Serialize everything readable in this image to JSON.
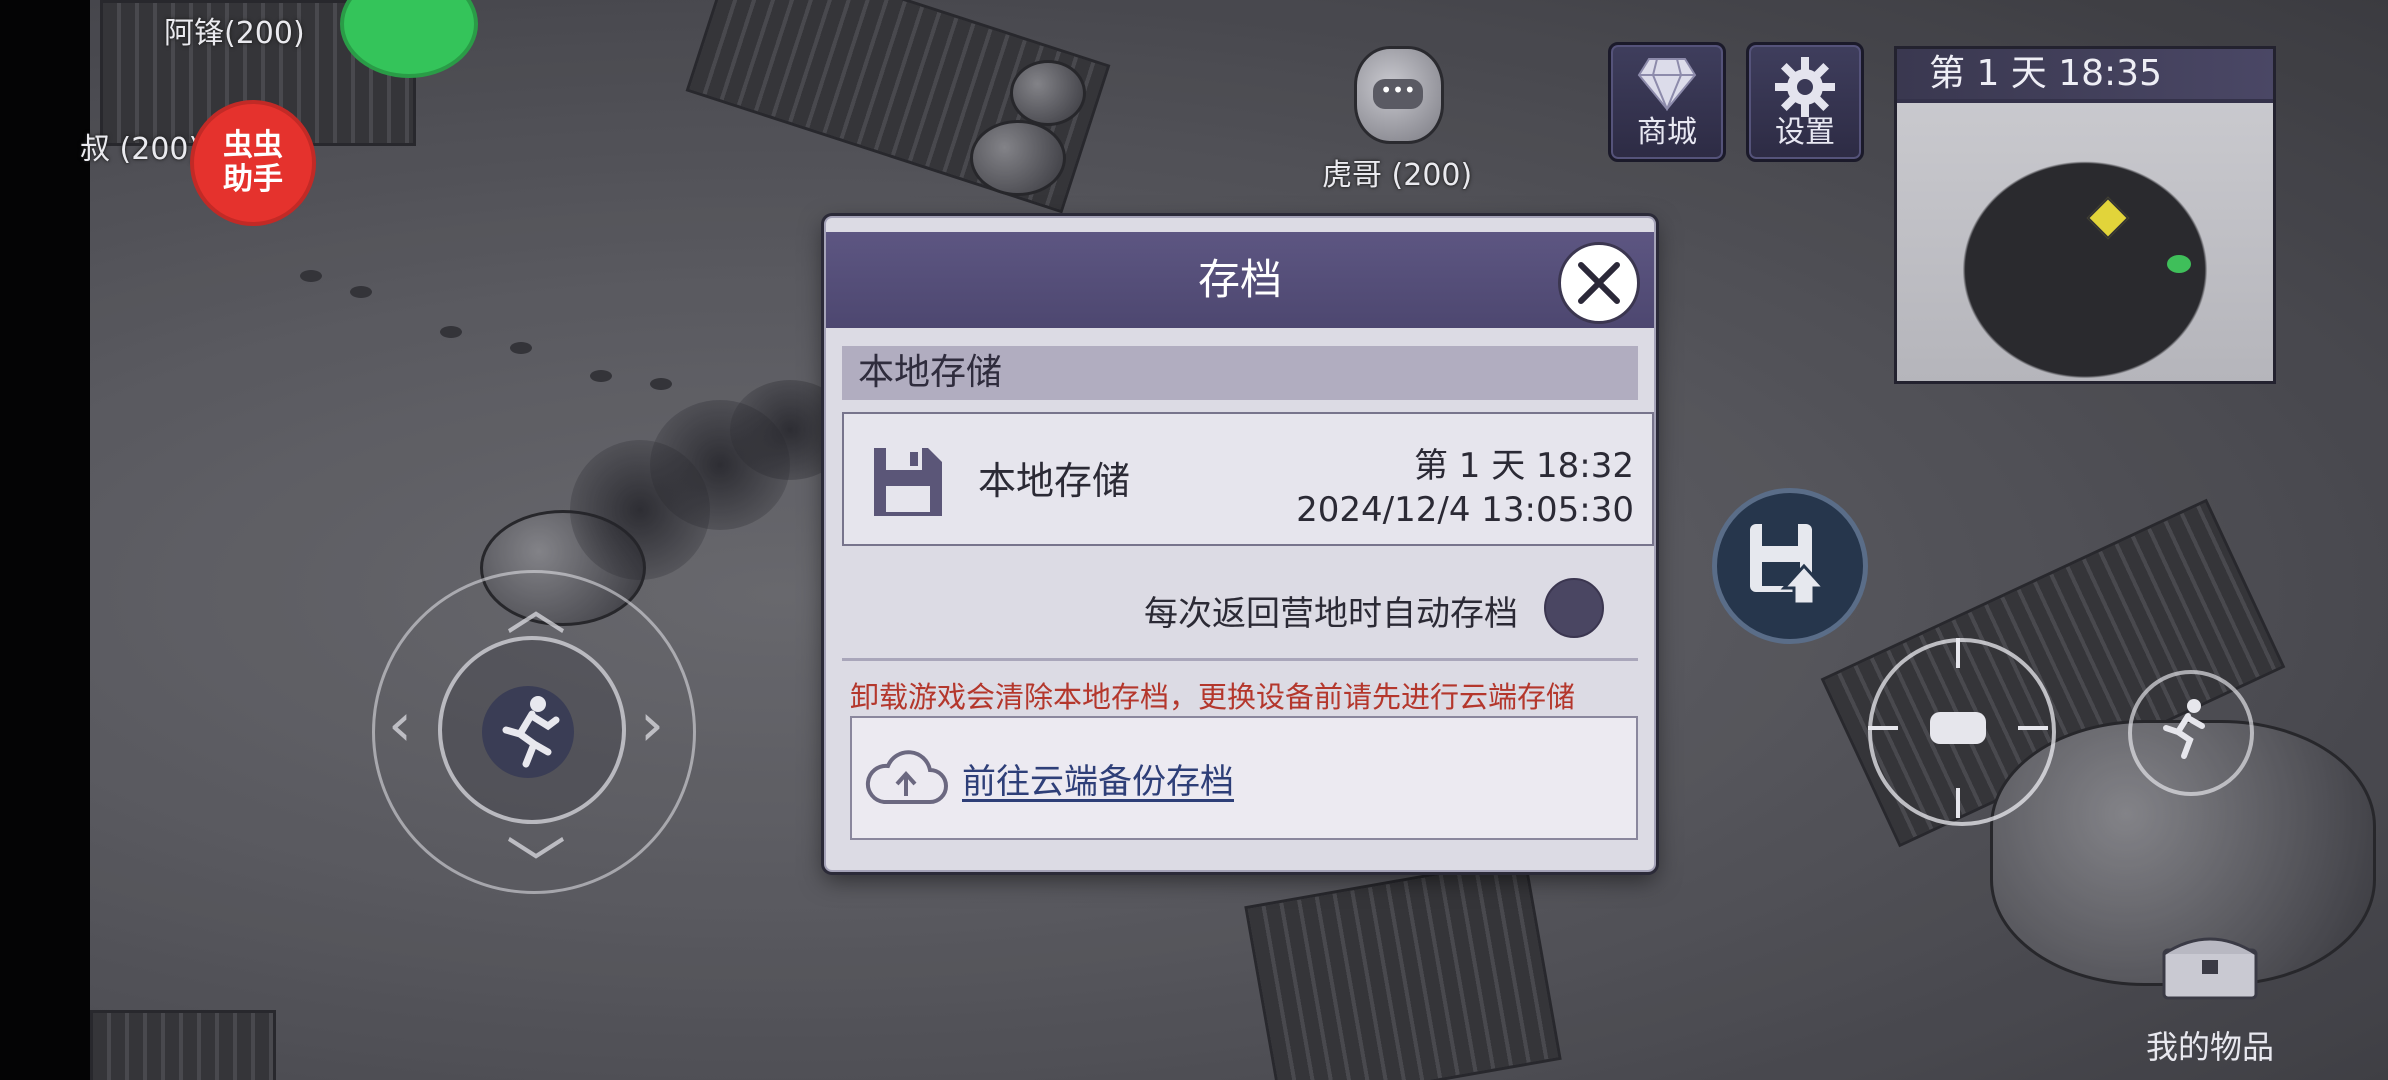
{
  "npcs": {
    "top_left_1": "阿锋(200)",
    "top_left_2": "叔 (200)",
    "top_center": "虎哥 (200)"
  },
  "hud": {
    "shop_label": "商城",
    "settings_label": "设置",
    "minimap_day": "第 1 天  18:35",
    "inventory_label": "我的物品",
    "helper_badge": "虫虫\n助手",
    "helper_line1": "虫虫",
    "helper_line2": "助手"
  },
  "modal": {
    "title": "存档",
    "section_label": "本地存储",
    "save_slot": {
      "name": "本地存储",
      "day": "第 1 天   18:32",
      "timestamp": "2024/12/4 13:05:30"
    },
    "auto_save_label": "每次返回营地时自动存档",
    "warning": "卸载游戏会清除本地存档，更换设备前请先进行云端存储",
    "cloud_link": "前往云端备份存档"
  },
  "colors": {
    "header_purple": "#5d5682",
    "warning_red": "#b4372c",
    "link_blue": "#2e3f78",
    "helper_red": "#e5322d"
  }
}
